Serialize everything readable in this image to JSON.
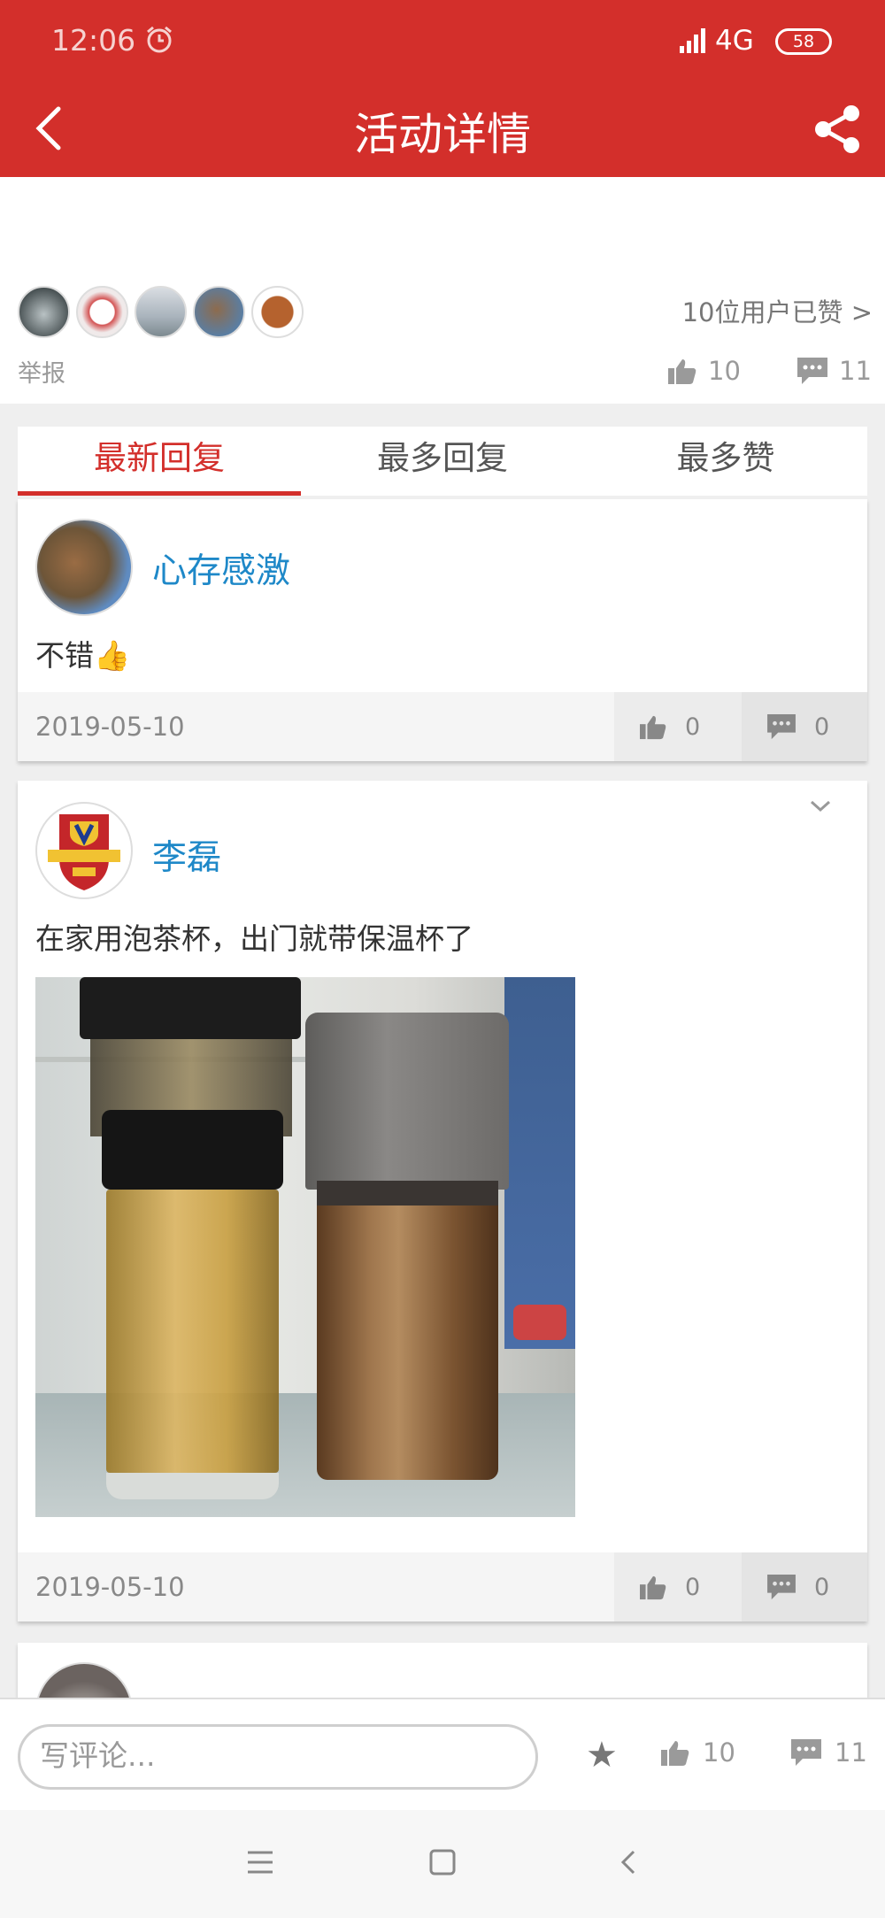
{
  "status_bar": {
    "time": "12:06",
    "network": "4G",
    "battery": "58"
  },
  "header": {
    "title": "活动详情"
  },
  "likes": {
    "text": "10位用户已赞 >",
    "report": "举报",
    "like_count": "10",
    "comment_count": "11"
  },
  "tabs": [
    {
      "label": "最新回复",
      "active": true
    },
    {
      "label": "最多回复",
      "active": false
    },
    {
      "label": "最多赞",
      "active": false
    }
  ],
  "comments": [
    {
      "user": "心存感激",
      "text": "不错👍",
      "date": "2019-05-10",
      "likes": "0",
      "replies": "0"
    },
    {
      "user": "李磊",
      "text": "在家用泡茶杯，出门就带保温杯了",
      "date": "2019-05-10",
      "likes": "0",
      "replies": "0"
    }
  ],
  "bottom": {
    "placeholder": "写评论...",
    "like_count": "10",
    "comment_count": "11"
  },
  "colors": {
    "brand": "#d32f2b",
    "username": "#1e88c8"
  }
}
